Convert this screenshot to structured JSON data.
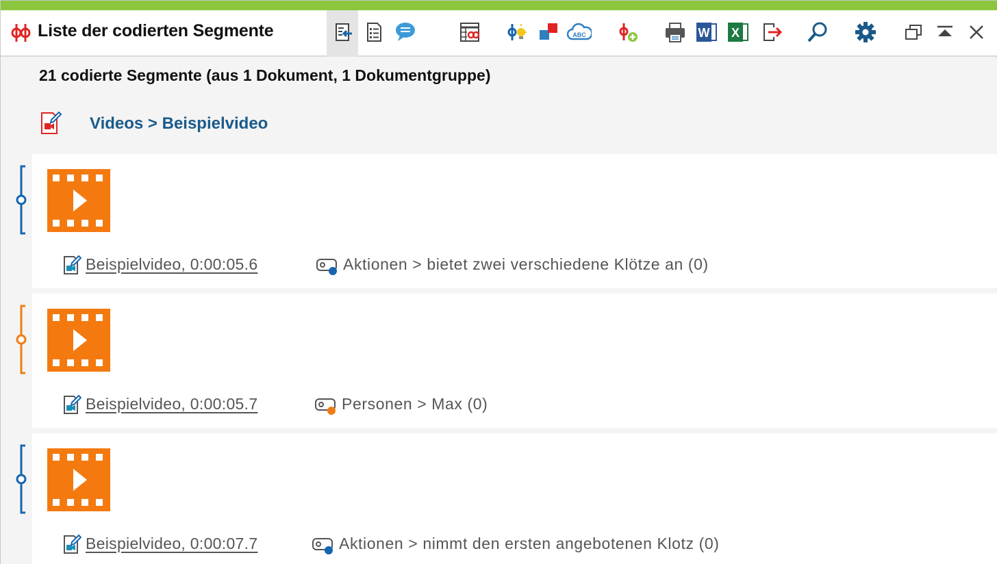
{
  "window": {
    "title": "Liste der codierten Segmente",
    "accent_color": "#8cc63f"
  },
  "toolbar": {
    "buttons": [
      {
        "name": "apply-to-document-button",
        "icon": "document-arrow-icon",
        "active": true
      },
      {
        "name": "list-view-button",
        "icon": "list-document-icon"
      },
      {
        "name": "memo-comments-button",
        "icon": "speech-bubble-icon"
      },
      {
        "name": "code-matrix-button",
        "icon": "table-codes-icon"
      },
      {
        "name": "paraphrase-button",
        "icon": "code-lightbulb-icon"
      },
      {
        "name": "color-codes-button",
        "icon": "color-squares-icon"
      },
      {
        "name": "word-cloud-button",
        "icon": "cloud-abc-icon"
      },
      {
        "name": "add-code-button",
        "icon": "code-plus-icon"
      },
      {
        "name": "print-button",
        "icon": "printer-icon"
      },
      {
        "name": "export-word-button",
        "icon": "word-icon"
      },
      {
        "name": "export-excel-button",
        "icon": "excel-icon"
      },
      {
        "name": "export-button",
        "icon": "export-arrow-icon"
      },
      {
        "name": "search-button",
        "icon": "search-icon"
      },
      {
        "name": "settings-button",
        "icon": "gear-icon"
      },
      {
        "name": "undock-button",
        "icon": "undock-window-icon"
      },
      {
        "name": "collapse-button",
        "icon": "collapse-up-icon"
      },
      {
        "name": "close-button",
        "icon": "close-icon"
      }
    ]
  },
  "summary": {
    "text": "21 codierte Segmente (aus 1 Dokument, 1 Dokumentgruppe)"
  },
  "document": {
    "path": "Videos > Beispielvideo",
    "icon": "video-document-icon"
  },
  "segments": [
    {
      "source": "Beispielvideo, 0:00:05.6",
      "code": "Aktionen > bietet zwei verschiedene Klötze an (0)",
      "color": "#1565b0"
    },
    {
      "source": "Beispielvideo, 0:00:05.7",
      "code": "Personen > Max (0)",
      "color": "#f07d14"
    },
    {
      "source": "Beispielvideo, 0:00:07.7",
      "code": "Aktionen > nimmt den ersten angebotenen Klotz (0)",
      "color": "#1565b0"
    }
  ],
  "colors": {
    "link_blue": "#1a5a8a",
    "video_orange": "#f47a10",
    "code_blue": "#1565b0",
    "code_orange": "#f07d14"
  }
}
